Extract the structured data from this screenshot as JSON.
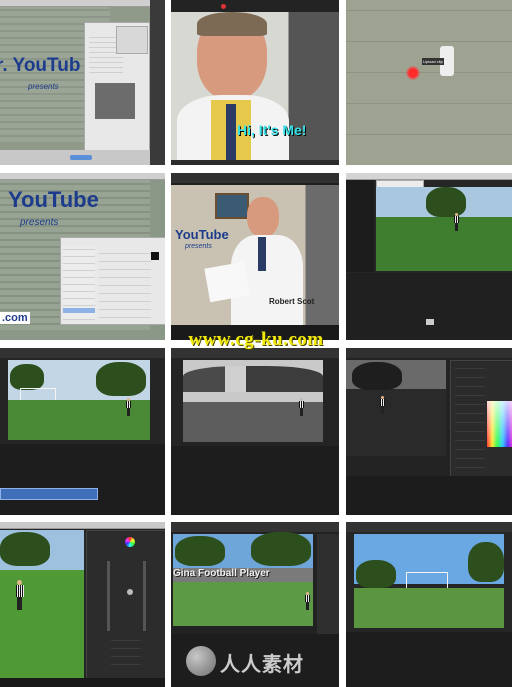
{
  "tiles": {
    "t1": {
      "title_text": "r. YouTub",
      "sub_text": "presents"
    },
    "t2": {
      "caption": "Hi, It's Me!"
    },
    "t3": {
      "tooltip": "Upload clip"
    },
    "t4": {
      "title_text": "YouTube",
      "sub_text": "presents",
      "bottom_text": ".com"
    },
    "t5": {
      "title_text": "YouTube",
      "sub_text": "presents",
      "nametag": "Robert Scot"
    },
    "t11": {
      "banner": "Gina Football Player"
    }
  },
  "watermark": {
    "text": "www.cg-ku.com"
  },
  "logo": {
    "text": "人人素材"
  },
  "colors": {
    "app_dark": "#2a2a2a",
    "timeline_clip": "#3e6fb8",
    "field_green": "#3f7d2f",
    "caption_cyan": "#36e3e8",
    "watermark_yellow": "#f2ea0a"
  }
}
